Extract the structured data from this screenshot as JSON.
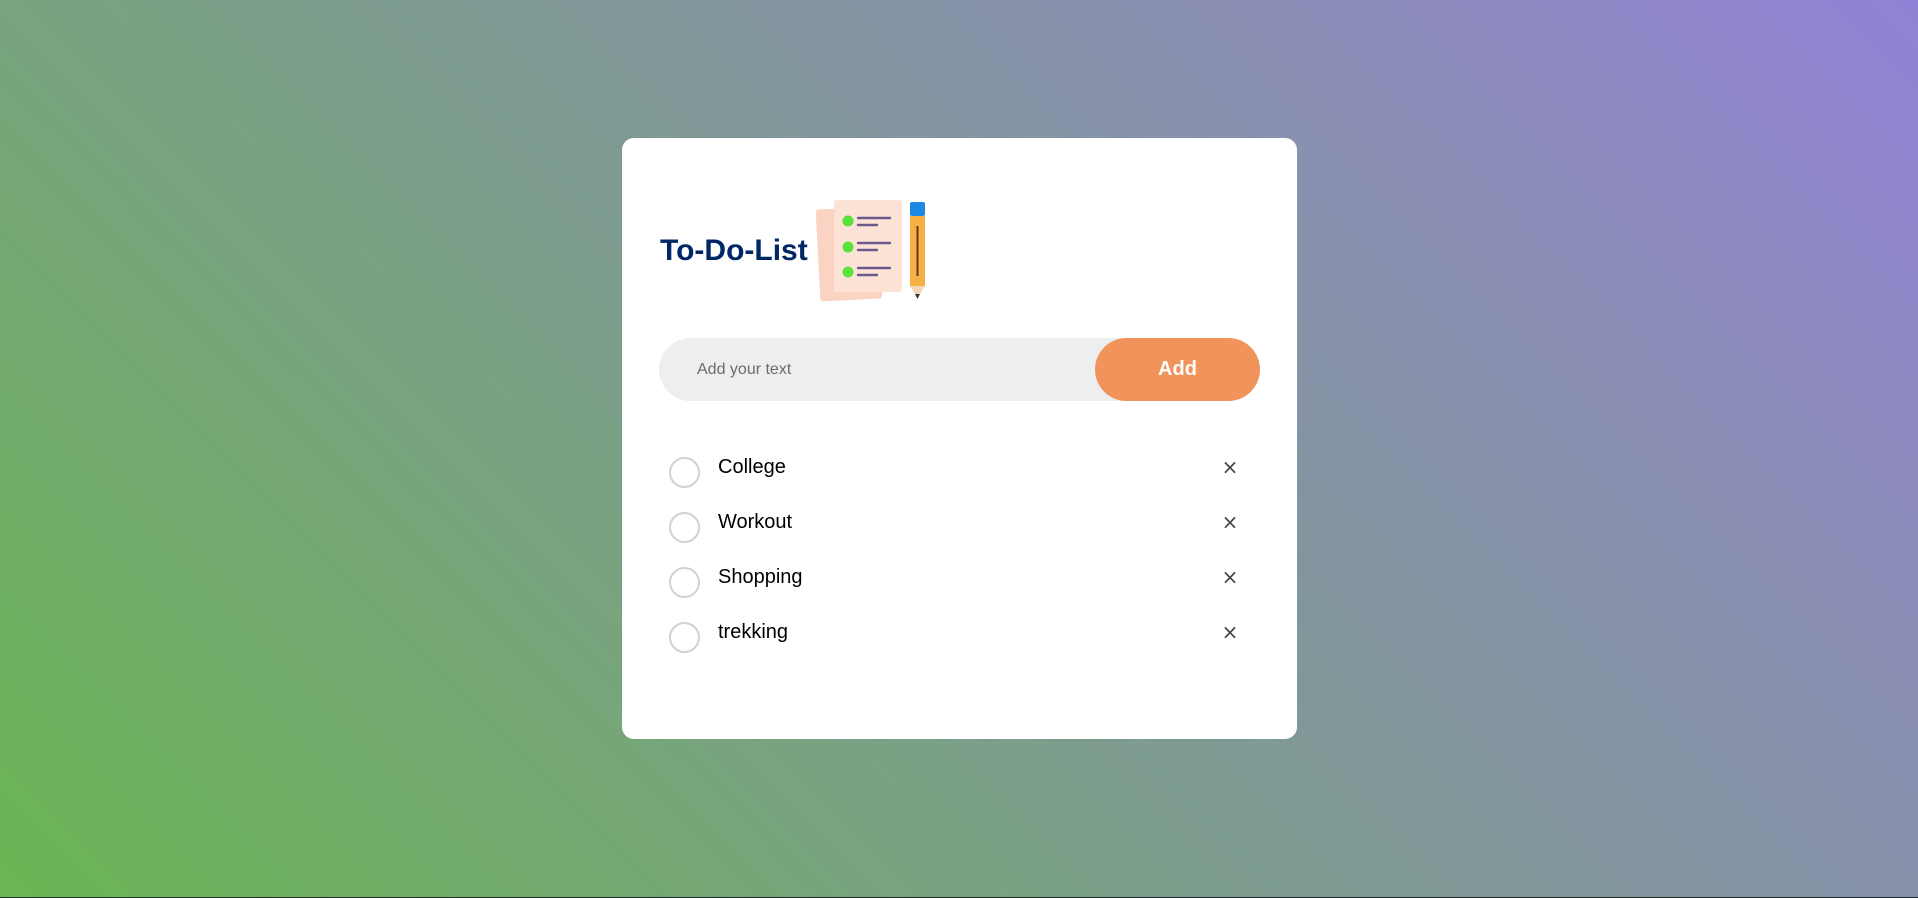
{
  "app": {
    "title": "To-Do-List",
    "logo_icon": "checklist-with-pencil-icon"
  },
  "input": {
    "placeholder": "Add your text",
    "value": ""
  },
  "add_button": {
    "label": "Add",
    "color": "#f0945b"
  },
  "tasks": [
    {
      "label": "College",
      "checked": false,
      "remove_icon": "close-icon",
      "remove_glyph": "×"
    },
    {
      "label": "Workout",
      "checked": false,
      "remove_icon": "close-icon",
      "remove_glyph": "×"
    },
    {
      "label": "Shopping",
      "checked": false,
      "remove_icon": "close-icon",
      "remove_glyph": "×"
    },
    {
      "label": "trekking",
      "checked": false,
      "remove_icon": "close-icon",
      "remove_glyph": "×"
    }
  ],
  "colors": {
    "title": "#002765",
    "background_start": "#6bb654",
    "background_end": "#9181d6"
  }
}
